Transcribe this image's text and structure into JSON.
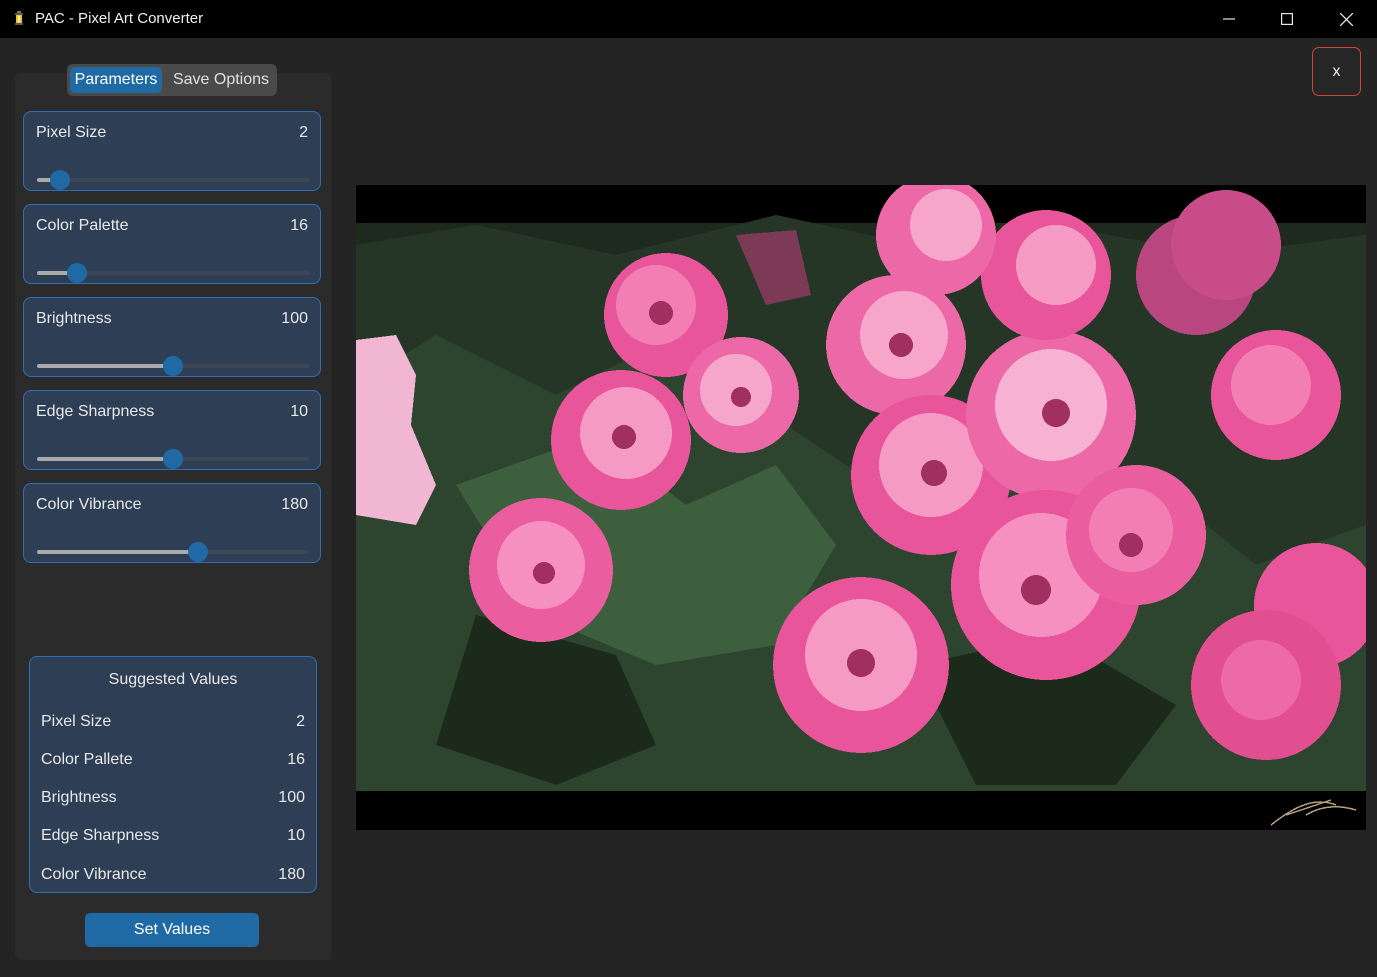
{
  "window": {
    "title": "PAC - Pixel Art Converter",
    "minimize_icon": "minimize-icon",
    "maximize_icon": "maximize-icon",
    "close_icon": "close-icon"
  },
  "tabs": [
    {
      "label": "Parameters",
      "active": true
    },
    {
      "label": "Save Options",
      "active": false
    }
  ],
  "parameters": [
    {
      "label": "Pixel Size",
      "value": "2",
      "level": 0.05
    },
    {
      "label": "Color Palette",
      "value": "16",
      "level": 0.12
    },
    {
      "label": "Brightness",
      "value": "100",
      "level": 0.5
    },
    {
      "label": "Edge Sharpness",
      "value": "10",
      "level": 0.5
    },
    {
      "label": "Color Vibrance",
      "value": "180",
      "level": 0.6
    }
  ],
  "suggested": {
    "title": "Suggested Values",
    "rows": [
      {
        "label": "Pixel Size",
        "value": "2"
      },
      {
        "label": "Color Pallete",
        "value": "16"
      },
      {
        "label": "Brightness",
        "value": "100"
      },
      {
        "label": "Edge Sharpness",
        "value": "10"
      },
      {
        "label": "Color Vibrance",
        "value": "180"
      }
    ]
  },
  "set_values_label": "Set Values",
  "close_preview_label": "x",
  "colors": {
    "accent": "#1f6aa5",
    "card_bg": "#2e3f55",
    "card_border": "#2f6eb4",
    "close_border": "#d0443a"
  },
  "preview": {
    "subject": "pixelated pink roses with dark green foliage",
    "signature_icon": "signature-mark"
  }
}
